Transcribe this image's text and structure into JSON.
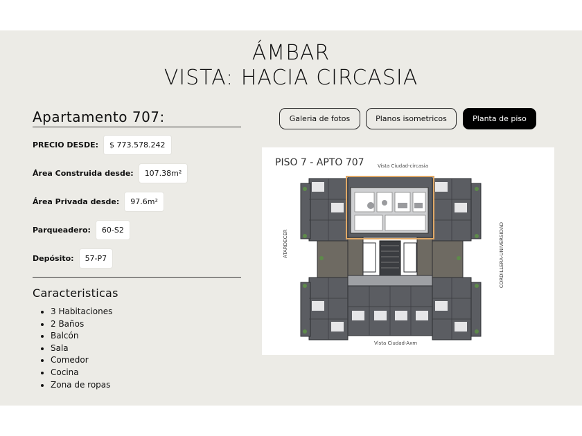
{
  "header": {
    "project": "ÁMBAR",
    "view": "VISTA: HACIA CIRCASIA"
  },
  "apartment": {
    "title": "Apartamento 707:",
    "fields": [
      {
        "label": "PRECIO DESDE:",
        "value": "$ 773.578.242"
      },
      {
        "label": "Área Construida desde:",
        "value": "107.38m²"
      },
      {
        "label": "Área Privada desde:",
        "value": "97.6m²"
      },
      {
        "label": "Parqueadero:",
        "value": "60-S2"
      },
      {
        "label": "Depósito:",
        "value": "57-P7"
      }
    ]
  },
  "features": {
    "title": "Caracteristicas",
    "items": [
      "3 Habitaciones",
      "2 Baños",
      "Balcón",
      "Sala",
      "Comedor",
      "Cocina",
      "Zona de ropas"
    ]
  },
  "tabs": [
    {
      "label": "Galeria de fotos",
      "active": false
    },
    {
      "label": "Planos isometricos",
      "active": false
    },
    {
      "label": "Planta de piso",
      "active": true
    }
  ],
  "floorplan": {
    "title": "PISO 7 - APTO 707",
    "top_label": "Vista Ciudad-circasia",
    "bottom_label": "Vista Ciudad-Axm",
    "left_label": "ATARDECER",
    "right_label": "CORDILLERA-UNIVERSIDAD",
    "highlight_color": "#e0a866"
  }
}
